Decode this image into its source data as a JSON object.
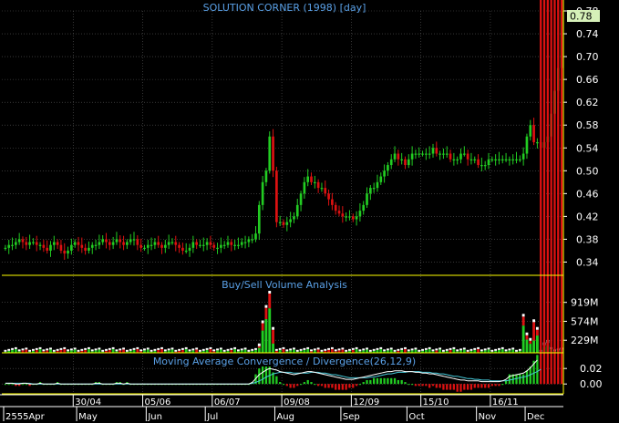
{
  "window": {
    "title": "SOLUTION CORNER (1998) [day]",
    "current_price_badge": "0.78"
  },
  "panels": {
    "volume_title": "Buy/Sell Volume Analysis",
    "macd_title": "Moving Average Convergence / Divergence(26,12,9)"
  },
  "colors": {
    "background": "#000000",
    "grid": "#5a5a5a",
    "frame": "#ffff00",
    "title_text": "#5aa0e6",
    "axis_text": "#ffffff",
    "up_candle": "#22cc22",
    "down_candle": "#dd1111",
    "macd_line": "#ffffff",
    "signal_line": "#44c8d8",
    "badge_bg": "#d6f0b8"
  },
  "chart_data": [
    {
      "type": "candlestick",
      "title": "SOLUTION CORNER (1998) [day]",
      "ylim": [
        0.32,
        0.78
      ],
      "y_ticks": [
        "0.78",
        "0.74",
        "0.70",
        "0.66",
        "0.62",
        "0.58",
        "0.54",
        "0.50",
        "0.46",
        "0.42",
        "0.38",
        "0.34"
      ],
      "x_date_labels": [
        "30/04",
        "05/06",
        "06/07",
        "09/08",
        "12/09",
        "15/10",
        "16/11"
      ],
      "x_month_labels": [
        "2555Apr",
        "May",
        "Jun",
        "Jul",
        "Aug",
        "Sep",
        "Oct",
        "Nov",
        "Dec"
      ],
      "last_close": 0.78,
      "closes": [
        0.365,
        0.37,
        0.37,
        0.375,
        0.38,
        0.375,
        0.37,
        0.375,
        0.375,
        0.37,
        0.37,
        0.365,
        0.36,
        0.37,
        0.375,
        0.37,
        0.36,
        0.355,
        0.36,
        0.37,
        0.375,
        0.37,
        0.365,
        0.36,
        0.365,
        0.37,
        0.37,
        0.375,
        0.38,
        0.375,
        0.37,
        0.375,
        0.38,
        0.375,
        0.37,
        0.375,
        0.38,
        0.38,
        0.37,
        0.365,
        0.365,
        0.37,
        0.37,
        0.375,
        0.37,
        0.365,
        0.37,
        0.375,
        0.375,
        0.37,
        0.365,
        0.36,
        0.36,
        0.365,
        0.375,
        0.37,
        0.37,
        0.37,
        0.375,
        0.37,
        0.365,
        0.365,
        0.37,
        0.37,
        0.375,
        0.37,
        0.37,
        0.37,
        0.375,
        0.375,
        0.38,
        0.38,
        0.39,
        0.44,
        0.48,
        0.5,
        0.56,
        0.5,
        0.41,
        0.41,
        0.405,
        0.41,
        0.415,
        0.42,
        0.44,
        0.46,
        0.48,
        0.49,
        0.48,
        0.48,
        0.47,
        0.47,
        0.46,
        0.45,
        0.44,
        0.43,
        0.425,
        0.42,
        0.42,
        0.42,
        0.415,
        0.42,
        0.43,
        0.44,
        0.46,
        0.47,
        0.47,
        0.48,
        0.49,
        0.5,
        0.51,
        0.52,
        0.53,
        0.52,
        0.52,
        0.51,
        0.52,
        0.53,
        0.53,
        0.53,
        0.53,
        0.53,
        0.53,
        0.54,
        0.53,
        0.53,
        0.53,
        0.53,
        0.52,
        0.52,
        0.52,
        0.53,
        0.53,
        0.52,
        0.52,
        0.52,
        0.51,
        0.51,
        0.51,
        0.52,
        0.52,
        0.52,
        0.52,
        0.52,
        0.52,
        0.52,
        0.52,
        0.52,
        0.52,
        0.53,
        0.56,
        0.58,
        0.55,
        0.55,
        0.54,
        0.55,
        0.56,
        0.6,
        0.64,
        0.68,
        0.78
      ]
    },
    {
      "type": "bar",
      "title": "Buy/Sell Volume Analysis",
      "y_ticks": [
        "919M",
        "574M",
        "229M"
      ],
      "y_tick_values": [
        919,
        574,
        229
      ],
      "unit": "M",
      "ylim": [
        0,
        1130
      ],
      "spikes": [
        {
          "index": 76,
          "value": 1080
        },
        {
          "index": 75,
          "value": 820
        },
        {
          "index": 74,
          "value": 540
        },
        {
          "index": 77,
          "value": 420
        },
        {
          "index": 73,
          "value": 120
        },
        {
          "index": 150,
          "value": 320
        },
        {
          "index": 151,
          "value": 220
        },
        {
          "index": 149,
          "value": 660
        },
        {
          "index": 152,
          "value": 560
        },
        {
          "index": 153,
          "value": 420
        },
        {
          "index": 155,
          "value": 140
        },
        {
          "index": 156,
          "value": 180
        }
      ]
    },
    {
      "type": "line",
      "title": "Moving Average Convergence / Divergence(26,12,9)",
      "y_ticks": [
        "0.02",
        "0.00"
      ],
      "ylim": [
        -0.008,
        0.032
      ],
      "series": [
        {
          "values": [
            0.001,
            0.001,
            0.001,
            0.0,
            0.0,
            0.001,
            0.001,
            0.0,
            0.0,
            0.0,
            0.001,
            0.0,
            0.0,
            0.0,
            0.0,
            0.001,
            0.0,
            0.0,
            0.0,
            0.0,
            0.0,
            0.0,
            0.0,
            0.0,
            0.0,
            0.0,
            0.001,
            0.001,
            0.0,
            0.0,
            0.0,
            0.0,
            0.001,
            0.001,
            0.0,
            0.001,
            0.0,
            0.0,
            0.0,
            0.0,
            0.0,
            0.0,
            0.0,
            0.0,
            0.0,
            0.0,
            0.0,
            0.0,
            0.0,
            0.0,
            0.0,
            0.0,
            0.0,
            0.0,
            0.0,
            0.0,
            0.0,
            0.0,
            0.0,
            0.0,
            0.0,
            0.0,
            0.0,
            0.0,
            0.0,
            0.0,
            0.0,
            0.0,
            0.0,
            0.0,
            0.0,
            0.002,
            0.007,
            0.012,
            0.015,
            0.018,
            0.02,
            0.019,
            0.018,
            0.016,
            0.015,
            0.014,
            0.013,
            0.012,
            0.013,
            0.014,
            0.015,
            0.016,
            0.016,
            0.015,
            0.014,
            0.013,
            0.012,
            0.011,
            0.01,
            0.009,
            0.008,
            0.007,
            0.006,
            0.006,
            0.006,
            0.007,
            0.008,
            0.009,
            0.01,
            0.011,
            0.012,
            0.013,
            0.014,
            0.015,
            0.016,
            0.016,
            0.017,
            0.017,
            0.017,
            0.016,
            0.016,
            0.016,
            0.015,
            0.015,
            0.014,
            0.014,
            0.013,
            0.013,
            0.012,
            0.011,
            0.01,
            0.009,
            0.008,
            0.007,
            0.006,
            0.005,
            0.005,
            0.004,
            0.004,
            0.004,
            0.004,
            0.003,
            0.003,
            0.003,
            0.003,
            0.003,
            0.003,
            0.004,
            0.006,
            0.01,
            0.011,
            0.012,
            0.013,
            0.014,
            0.017,
            0.021,
            0.026,
            0.031
          ]
        },
        {
          "values": [
            0.001,
            0.001,
            0.001,
            0.001,
            0.001,
            0.001,
            0.001,
            0.001,
            0.0,
            0.0,
            0.0,
            0.0,
            0.0,
            0.0,
            0.0,
            0.0,
            0.0,
            0.0,
            0.0,
            0.0,
            0.0,
            0.0,
            0.0,
            0.0,
            0.0,
            0.0,
            0.0,
            0.0,
            0.0,
            0.0,
            0.0,
            0.0,
            0.0,
            0.0,
            0.0,
            0.0,
            0.0,
            0.0,
            0.0,
            0.0,
            0.0,
            0.0,
            0.0,
            0.0,
            0.0,
            0.0,
            0.0,
            0.0,
            0.0,
            0.0,
            0.0,
            0.0,
            0.0,
            0.0,
            0.0,
            0.0,
            0.0,
            0.0,
            0.0,
            0.0,
            0.0,
            0.0,
            0.0,
            0.0,
            0.0,
            0.0,
            0.0,
            0.0,
            0.0,
            0.0,
            0.0,
            0.001,
            0.002,
            0.004,
            0.006,
            0.009,
            0.011,
            0.013,
            0.014,
            0.015,
            0.015,
            0.015,
            0.015,
            0.014,
            0.014,
            0.014,
            0.014,
            0.014,
            0.015,
            0.015,
            0.015,
            0.014,
            0.014,
            0.013,
            0.012,
            0.012,
            0.011,
            0.01,
            0.009,
            0.008,
            0.008,
            0.008,
            0.008,
            0.008,
            0.008,
            0.009,
            0.009,
            0.01,
            0.011,
            0.012,
            0.013,
            0.013,
            0.014,
            0.015,
            0.015,
            0.015,
            0.016,
            0.016,
            0.016,
            0.016,
            0.015,
            0.015,
            0.015,
            0.014,
            0.014,
            0.013,
            0.013,
            0.012,
            0.011,
            0.01,
            0.01,
            0.009,
            0.008,
            0.007,
            0.007,
            0.006,
            0.006,
            0.005,
            0.005,
            0.005,
            0.004,
            0.004,
            0.004,
            0.004,
            0.004,
            0.005,
            0.006,
            0.007,
            0.008,
            0.009,
            0.01,
            0.012,
            0.014,
            0.016,
            0.019
          ]
        }
      ]
    }
  ]
}
